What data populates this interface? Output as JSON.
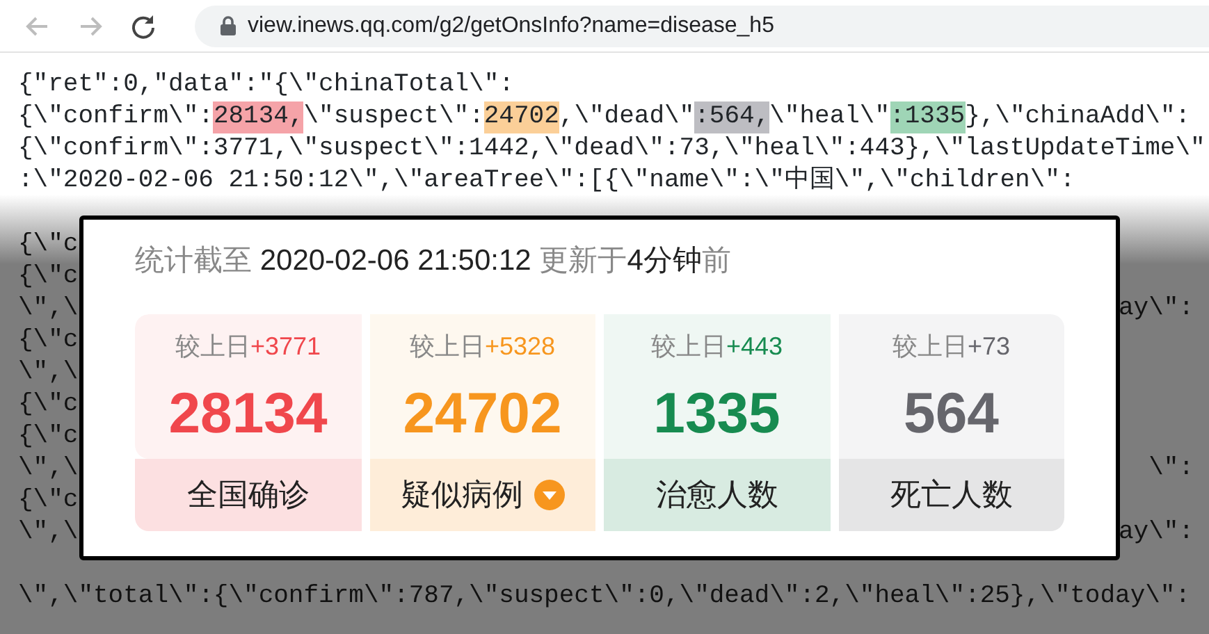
{
  "browser": {
    "nav_buttons": [
      {
        "kind": "back",
        "disabled": true
      },
      {
        "kind": "forward",
        "disabled": true
      },
      {
        "kind": "reload",
        "disabled": false
      }
    ],
    "url": "view.inews.qq.com/g2/getOnsInfo?name=disease_h5"
  },
  "json_lines": [
    {
      "kind": "full",
      "segments": [
        {
          "text": "{\"ret\":0,\"data\":\"{\\\"chinaTotal\\\":"
        }
      ]
    },
    {
      "kind": "full",
      "segments": [
        {
          "text": "{\\\"confirm\\\":"
        },
        {
          "text": "28134,",
          "color": "#f5a3a8"
        },
        {
          "text": "\\\"suspect\\\":"
        },
        {
          "text": "24702",
          "color": "#fbcf98"
        },
        {
          "text": ",\\\"dead\\\""
        },
        {
          "text": ":564,",
          "color": "#bdbdc2"
        },
        {
          "text": "\\\"heal\\\""
        },
        {
          "text": ":1335",
          "color": "#9fd5b6"
        },
        {
          "text": "},\\\"chinaAdd\\\":"
        }
      ]
    },
    {
      "kind": "full",
      "segments": [
        {
          "text": "{\\\"confirm\\\":3771,\\\"suspect\\\":1442,\\\"dead\\\":73,\\\"heal\\\":443},\\\"lastUpdateTime\\\""
        }
      ]
    },
    {
      "kind": "full",
      "segments": [
        {
          "text": ":\\\"2020-02-06 21:50:12\\\",\\\"areaTree\\\":[{\\\"name\\\":\\\"中国\\\",\\\"children\\\":"
        }
      ]
    },
    {
      "kind": "covered"
    },
    {
      "kind": "split",
      "left": "{\\\"c"
    },
    {
      "kind": "split",
      "left": "{\\\"c"
    },
    {
      "kind": "split",
      "left": "\\\",\\",
      "right": "ay\\\":"
    },
    {
      "kind": "split",
      "left": "{\\\"c"
    },
    {
      "kind": "split",
      "left": "\\\",\\"
    },
    {
      "kind": "split",
      "left": "{\\\"c"
    },
    {
      "kind": "split",
      "left": "{\\\"c"
    },
    {
      "kind": "split",
      "left": "\\\",\\",
      "right": "\\\":"
    },
    {
      "kind": "split",
      "left": "{\\\"c"
    },
    {
      "kind": "split",
      "left": "\\\",\\",
      "right": "ay\\\":"
    },
    {
      "kind": "covered"
    },
    {
      "kind": "full",
      "segments": [
        {
          "text": "\\\",\\\"total\\\":{\\\"confirm\\\":787,\\\"suspect\\\":0,\\\"dead\\\":2,\\\"heal\\\":25},\\\"today\\\":"
        }
      ]
    }
  ],
  "popup": {
    "heading": "统计截至 **2020-02-06 21:50:12** 更新于**4分钟**前",
    "stats": [
      {
        "prefix": "较上日",
        "delta": "+3771",
        "value": "28134",
        "label": "全国确诊",
        "color": "#f0474c",
        "has_menu": false
      },
      {
        "prefix": "较上日",
        "delta": "+5328",
        "value": "24702",
        "label": "疑似病例",
        "color": "#f7961e",
        "has_menu": true
      },
      {
        "prefix": "较上日",
        "delta": "+443",
        "value": "1335",
        "label": "治愈人数",
        "color": "#178b50",
        "has_menu": false
      },
      {
        "prefix": "较上日",
        "delta": "+73",
        "value": "564",
        "label": "死亡人数",
        "color": "#66666c",
        "has_menu": false
      }
    ]
  }
}
